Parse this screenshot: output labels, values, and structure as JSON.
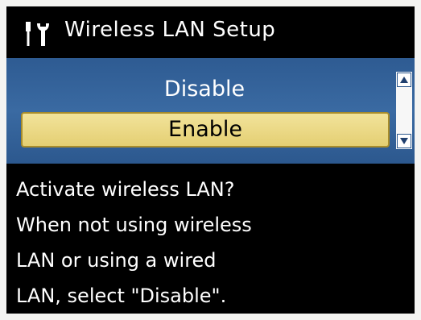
{
  "title": {
    "icon": "wrench-screwdriver-icon",
    "text": "Wireless LAN Setup"
  },
  "options": [
    {
      "label": "Disable",
      "selected": false
    },
    {
      "label": "Enable",
      "selected": true
    }
  ],
  "scrollbar": {
    "up_icon": "arrow-up-icon",
    "down_icon": "arrow-down-icon"
  },
  "message": {
    "lines": [
      "Activate wireless LAN?",
      "When not using wireless",
      "LAN or using a wired",
      "LAN, select \"Disable\"."
    ]
  },
  "colors": {
    "panel_blue": "#3a6aa2",
    "highlight_yellow": "#e9d77f",
    "background": "#000000"
  }
}
